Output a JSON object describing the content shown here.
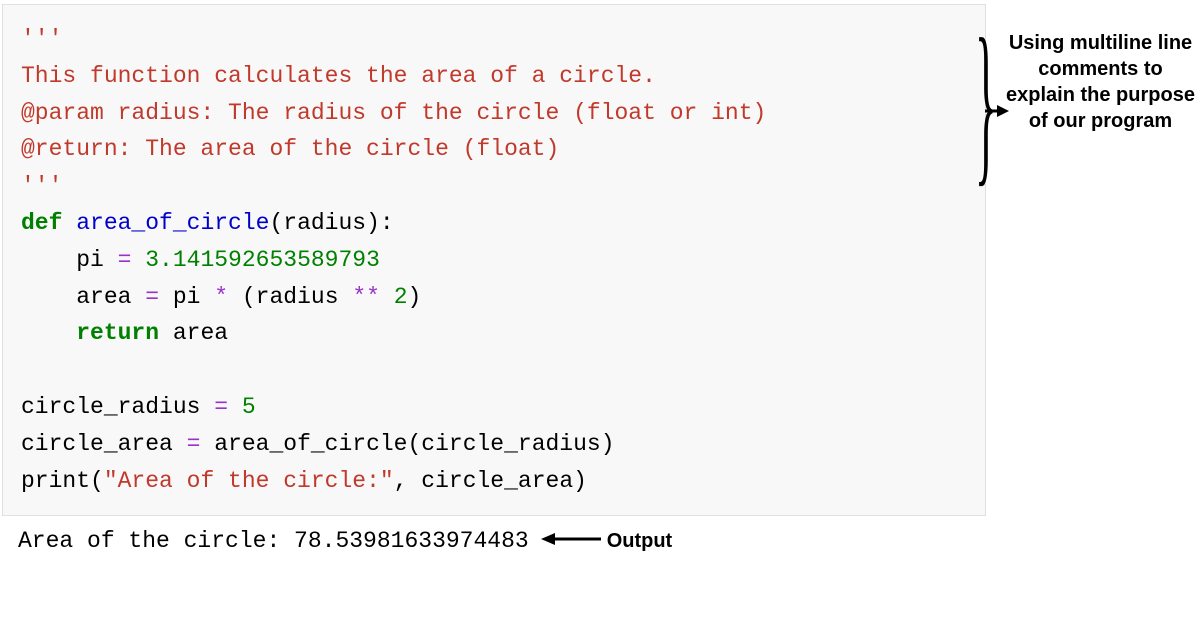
{
  "code": {
    "docstring_open": "'''",
    "docstring_line1": "This function calculates the area of a circle.",
    "docstring_line2": "@param radius: The radius of the circle (float or int)",
    "docstring_line3": "@return: The area of the circle (float)",
    "docstring_close": "'''",
    "def_kw": "def",
    "func_name": " area_of_circle",
    "func_params": "(radius):",
    "pi_assign_left": "    pi ",
    "eq1": "=",
    "pi_value": " 3.141592653589793",
    "area_assign_left": "    area ",
    "eq2": "=",
    "area_mid1": " pi ",
    "star": "*",
    "area_mid2": " (radius ",
    "dstar": "**",
    "area_mid3": " ",
    "two": "2",
    "area_end": ")",
    "return_kw": "    return",
    "return_var": " area",
    "cr_left": "circle_radius ",
    "eq3": "=",
    "cr_val": " 5",
    "ca_left": "circle_area ",
    "eq4": "=",
    "ca_call": " area_of_circle(circle_radius)",
    "print_name": "print",
    "print_open": "(",
    "print_str": "\"Area of the circle:\"",
    "print_rest": ", circle_area)"
  },
  "output": "Area of the circle: 78.53981633974483",
  "annotations": {
    "brace_text": "Using multiline line comments to explain the purpose of our program",
    "output_label": "Output"
  }
}
